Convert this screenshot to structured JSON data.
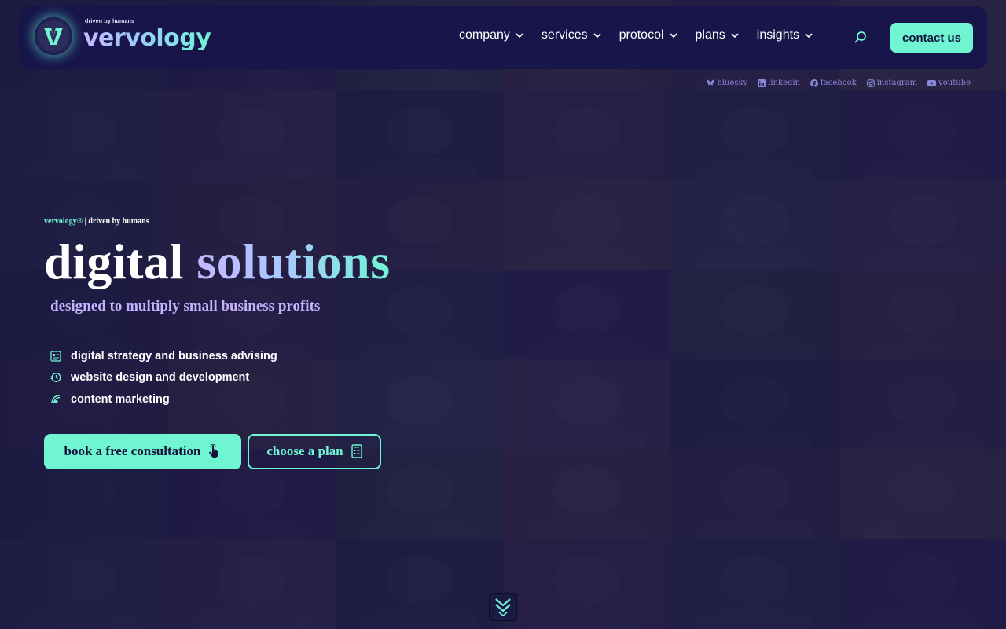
{
  "brand": {
    "tagline": "driven by humans",
    "name": "vervology"
  },
  "nav": {
    "items": [
      {
        "label": "company"
      },
      {
        "label": "services"
      },
      {
        "label": "protocol"
      },
      {
        "label": "plans"
      },
      {
        "label": "insights"
      }
    ],
    "search_icon": "search-icon",
    "contact_label": "contact us"
  },
  "social": [
    {
      "label": "bluesky",
      "icon": "bluesky-icon"
    },
    {
      "label": "linkedin",
      "icon": "linkedin-icon"
    },
    {
      "label": "facebook",
      "icon": "facebook-icon"
    },
    {
      "label": "instagram",
      "icon": "instagram-icon"
    },
    {
      "label": "youtube",
      "icon": "youtube-icon"
    }
  ],
  "hero": {
    "eyebrow_brand": "vervology®",
    "eyebrow_rest": " | driven by humans",
    "headline_word1": "digital",
    "headline_word2": "solutions",
    "subhead": "designed to multiply small business profits",
    "features": [
      {
        "label": "digital strategy and business advising",
        "icon": "strategy-icon"
      },
      {
        "label": "website design and development",
        "icon": "website-icon"
      },
      {
        "label": "content marketing",
        "icon": "marketing-icon"
      }
    ],
    "primary_cta": "book a free consultation",
    "secondary_cta": "choose a plan"
  },
  "colors": {
    "accent": "#6ff5d2",
    "background": "#1a1840",
    "header": "#17154a",
    "subhead": "#c3b2ff"
  }
}
